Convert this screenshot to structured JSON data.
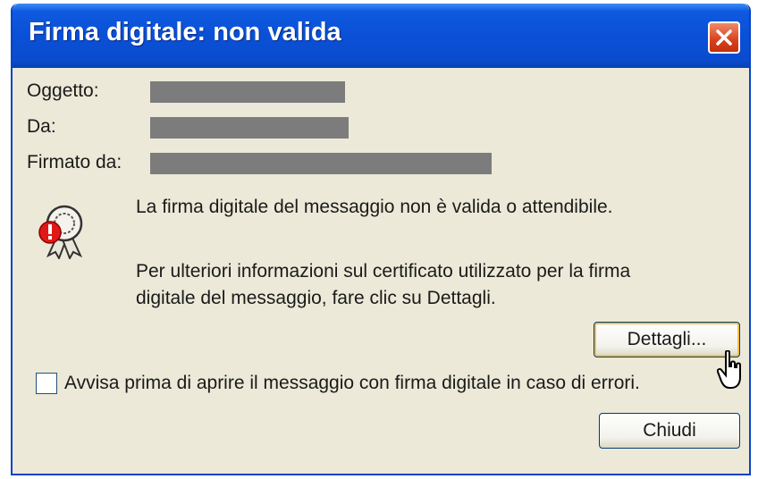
{
  "dialog": {
    "title": "Firma digitale: non valida",
    "close_icon": "close-icon"
  },
  "fields": {
    "oggetto_label": "Oggetto:",
    "da_label": "Da:",
    "firmato_label": "Firmato da:"
  },
  "message": {
    "icon": "certificate-warning-icon",
    "line1": "La firma digitale del messaggio non è valida o attendibile.",
    "line2a": "Per ulteriori informazioni sul certificato utilizzato per la firma",
    "line2b": "digitale del messaggio, fare clic su Dettagli."
  },
  "buttons": {
    "details_label": "Dettagli...",
    "close_label": "Chiudi"
  },
  "checkbox": {
    "label": "Avvisa prima di aprire il messaggio con firma digitale in caso di errori.",
    "checked": false
  },
  "colors": {
    "title_bar": "#0a50d6",
    "window_face": "#ece9d8",
    "close_button": "#d8401c",
    "redaction": "#7c7c7c"
  }
}
